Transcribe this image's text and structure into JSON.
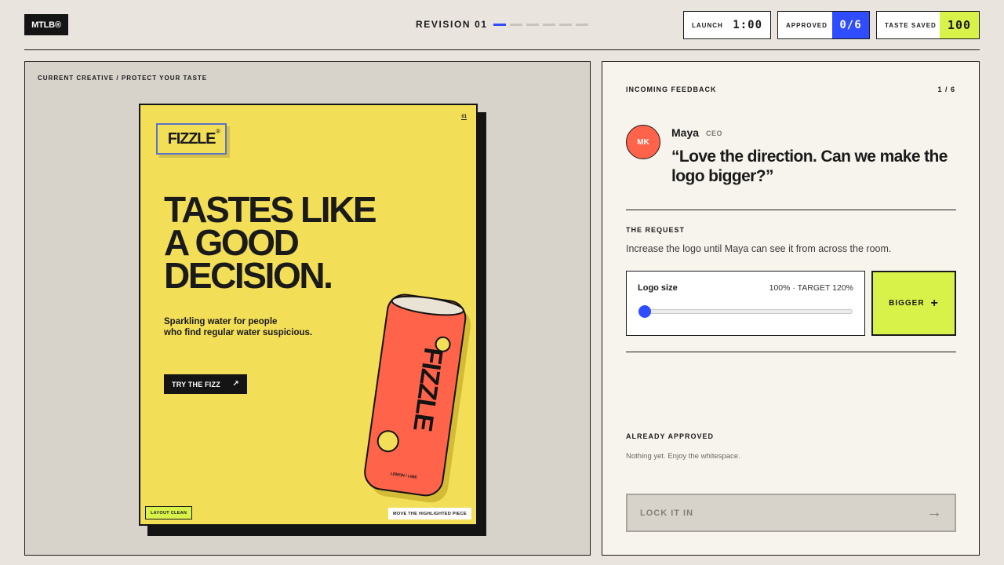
{
  "header": {
    "brand": "MTLB®",
    "revision_label": "REVISION 01",
    "revision_steps": 6,
    "revision_current": 1,
    "stats": {
      "launch_label": "LAUNCH",
      "launch_value": "1:00",
      "approved_label": "APPROVED",
      "approved_value": "0/6",
      "taste_label": "TASTE SAVED",
      "taste_value": "100"
    }
  },
  "creative": {
    "panel_title": "CURRENT CREATIVE / PROTECT YOUR TASTE",
    "logo_text": "FIZZLE",
    "logo_mark": "®",
    "page_number": "01",
    "headline": "TASTES LIKE\nA GOOD\nDECISION.",
    "subhead": "Sparkling water for people\nwho find regular water suspicious.",
    "cta_label": "TRY THE FIZZ",
    "cta_icon": "arrow-up-right-icon",
    "can_brand": "FIZZLE",
    "can_flavor": "LEMON / LIME",
    "tag_layout": "LAYOUT CLEAN",
    "tag_move": "MOVE THE HIGHLIGHTED PIECE"
  },
  "feedback": {
    "heading": "INCOMING FEEDBACK",
    "counter": "1 / 6",
    "avatar_initials": "MK",
    "person_name": "Maya",
    "person_role": "CEO",
    "quote": "“Love the direction. Can we make the logo bigger?”",
    "request_heading": "THE REQUEST",
    "request_text": "Increase the logo until Maya can see it from across the room.",
    "slider": {
      "label": "Logo size",
      "readout": "100% · TARGET 120%",
      "value_percent": 100,
      "min_percent": 100,
      "max_percent": 200
    },
    "bigger_label": "BIGGER",
    "approved_heading": "ALREADY APPROVED",
    "approved_text": "Nothing yet. Enjoy the whitespace.",
    "lock_label": "LOCK IT IN"
  },
  "colors": {
    "background": "#e9e5de",
    "accent_blue": "#2f4cff",
    "accent_lime": "#d9f24a",
    "poster_yellow": "#f3de58",
    "can_red": "#ff634a"
  }
}
